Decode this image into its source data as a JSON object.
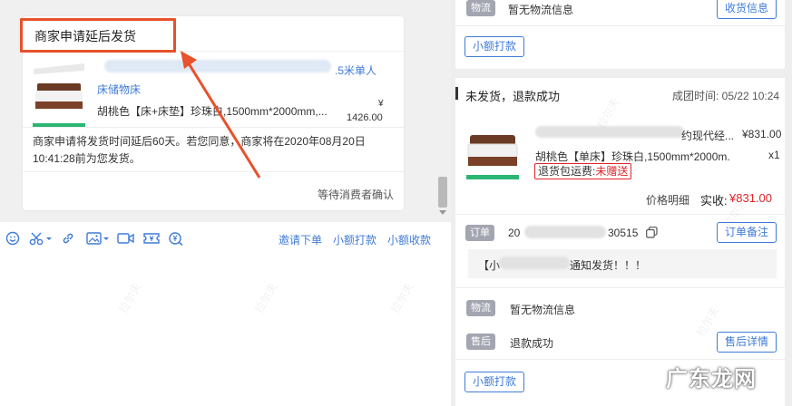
{
  "chat": {
    "card_title": "商家申请延后发货",
    "product": {
      "link_tail": ".5米单人",
      "link_line2": "床储物床",
      "spec": "胡桃色【床+床垫】珍珠白,1500mm*2000mm,...",
      "yen": "¥",
      "price": "1426.00"
    },
    "message": "商家申请将发货时间延后60天。若您同意，商家将在2020年08月20日 10:41:28前为您发货。",
    "status": "等待消费者确认"
  },
  "toolbar": {
    "icons": [
      "emoji-icon",
      "scissors-icon",
      "link-icon",
      "image-icon",
      "video-icon",
      "coupon-icon",
      "search-coin-icon"
    ],
    "links": [
      "邀请下单",
      "小额打款",
      "小额收款"
    ]
  },
  "order_top": {
    "logistics_tag": "物流",
    "logistics_text": "暂无物流信息",
    "receive_info_button": "收货信息",
    "small_payment_button": "小额打款"
  },
  "order": {
    "status_title": "未发货，退款成功",
    "deal_time": "成团时间: 05/22 10:24",
    "shop_name_tail": "约现代经...",
    "price": "¥831.00",
    "spec": "胡桃色【单床】珍珠白,1500mm*2000m...",
    "qty": "x1",
    "return_shipping_label": "退货包运费:",
    "return_shipping_value": "未赠送",
    "price_detail": "价格明细",
    "actual_pay_label": "实收:",
    "actual_pay_value": "¥831.00",
    "order_tag": "订单",
    "order_no_head": "20",
    "order_no_tail": "30515",
    "order_note_button": "订单备注",
    "note_head": "【小",
    "note_tail": "通知发货！！！",
    "logistics_tag": "物流",
    "logistics_text": "暂无物流信息",
    "aftersale_tag": "售后",
    "aftersale_text": "退款成功",
    "aftersale_button": "售后详情",
    "small_payment_button": "小额打款"
  },
  "watermark_text": "拉尔夫",
  "site_watermark": "广东龙网",
  "colors": {
    "accent": "#3f7bd6",
    "highlight_red": "#e8512b",
    "price_red": "#e0252b",
    "tag_grey": "#a3a6b1"
  }
}
